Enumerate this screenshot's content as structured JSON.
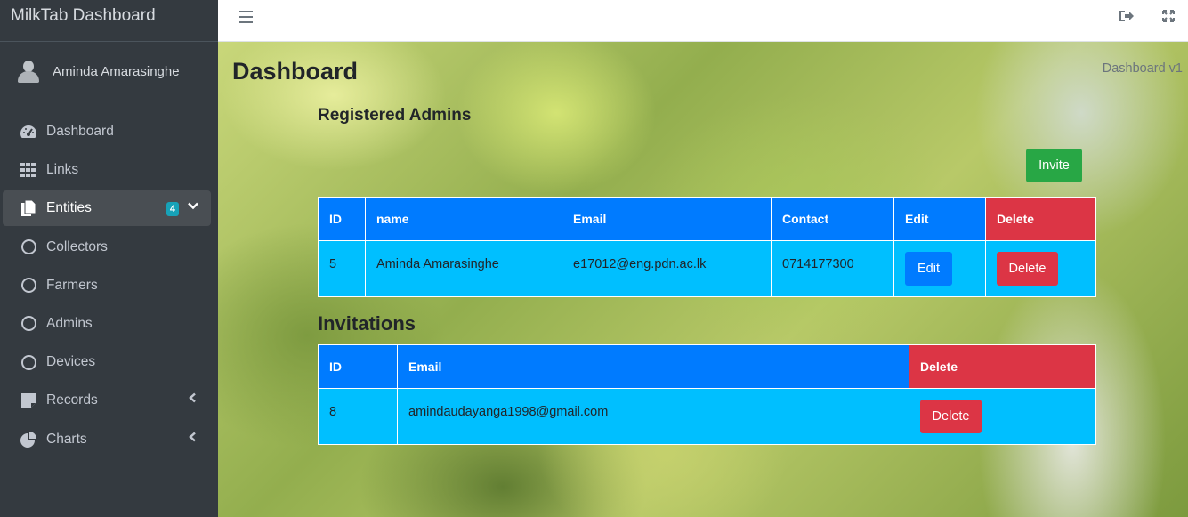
{
  "brand": "MilkTab Dashboard",
  "user": {
    "name": "Aminda Amarasinghe"
  },
  "sidebar": {
    "items": [
      {
        "label": "Dashboard",
        "icon": "tachometer-icon"
      },
      {
        "label": "Links",
        "icon": "grid-icon"
      },
      {
        "label": "Entities",
        "icon": "copy-icon",
        "badge": "4",
        "active": true
      },
      {
        "label": "Collectors",
        "icon": "circle-icon"
      },
      {
        "label": "Farmers",
        "icon": "circle-icon"
      },
      {
        "label": "Admins",
        "icon": "circle-icon"
      },
      {
        "label": "Devices",
        "icon": "circle-icon"
      },
      {
        "label": "Records",
        "icon": "sticky-note-icon"
      },
      {
        "label": "Charts",
        "icon": "pie-chart-icon"
      }
    ]
  },
  "header": {
    "title": "Dashboard",
    "breadcrumb": "Dashboard v1"
  },
  "admins": {
    "title": "Registered Admins",
    "invite_label": "Invite",
    "columns": [
      "ID",
      "name",
      "Email",
      "Contact",
      "Edit",
      "Delete"
    ],
    "rows": [
      {
        "id": "5",
        "name": "Aminda Amarasinghe",
        "email": "e17012@eng.pdn.ac.lk",
        "contact": "0714177300",
        "edit_label": "Edit",
        "delete_label": "Delete"
      }
    ]
  },
  "invitations": {
    "title": "Invitations",
    "columns": [
      "ID",
      "Email",
      "Delete"
    ],
    "rows": [
      {
        "id": "8",
        "email": "amindaudayanga1998@gmail.com",
        "delete_label": "Delete"
      }
    ]
  },
  "colors": {
    "sidebar": "#343a40",
    "primary": "#007bff",
    "danger": "#dc3545",
    "success": "#28a745",
    "cell": "#00bfff",
    "badge": "#17a2b8"
  }
}
